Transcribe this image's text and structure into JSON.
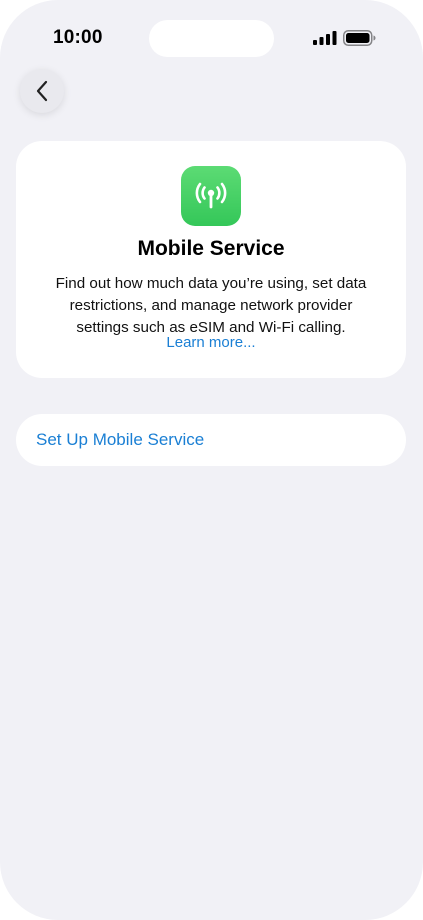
{
  "status_bar": {
    "time": "10:00",
    "signal_icon": "cellular-signal-icon",
    "battery_icon": "battery-icon"
  },
  "nav": {
    "back_icon": "chevron-left-icon"
  },
  "info_card": {
    "icon": "antenna-icon",
    "icon_color": "#34c759",
    "title": "Mobile Service",
    "description": "Find out how much data you’re using, set data restrictions, and manage network provider settings such as eSIM and Wi-Fi calling.",
    "learn_more": "Learn more..."
  },
  "actions": {
    "setup_label": "Set Up Mobile Service"
  },
  "colors": {
    "background": "#f1f1f6",
    "card": "#ffffff",
    "link": "#1a7fd4"
  }
}
